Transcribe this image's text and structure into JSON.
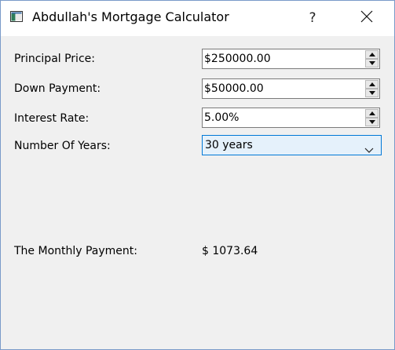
{
  "window": {
    "title": "Abdullah's Mortgage Calculator",
    "help_label": "?",
    "app_icon": "app-window-icon",
    "close_icon": "close-icon"
  },
  "form": {
    "principal": {
      "label": "Principal Price:",
      "value": "$250000.00"
    },
    "down_payment": {
      "label": "Down Payment:",
      "value": "$50000.00"
    },
    "interest_rate": {
      "label": "Interest Rate:",
      "value": "5.00%"
    },
    "years": {
      "label": "Number Of Years:",
      "value": "30 years"
    }
  },
  "result": {
    "label": "The Monthly Payment:",
    "value": "$ 1073.64"
  },
  "colors": {
    "background": "#f0f0f0",
    "titlebar": "#ffffff",
    "combo_focus_border": "#0078d7",
    "combo_focus_fill": "#e5f1fb"
  }
}
